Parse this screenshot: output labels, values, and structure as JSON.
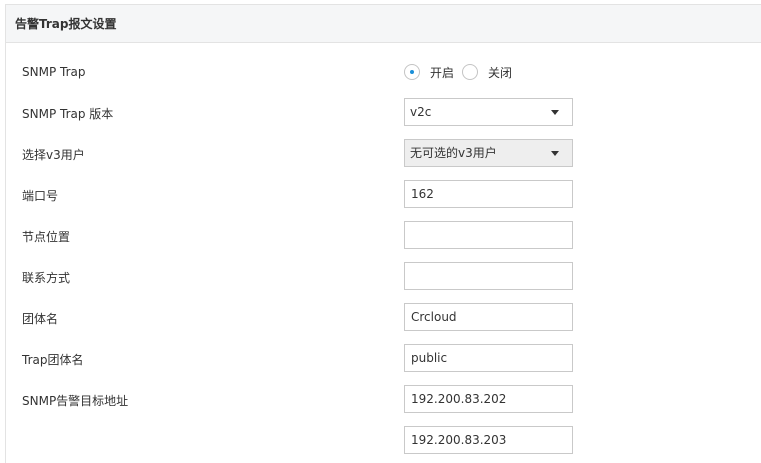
{
  "panel": {
    "title": "告警Trap报文设置"
  },
  "form": {
    "snmp_trap": {
      "label": "SNMP Trap",
      "options": [
        "开启",
        "关闭"
      ],
      "selected": "开启"
    },
    "trap_version": {
      "label": "SNMP Trap 版本",
      "value": "v2c"
    },
    "v3_user": {
      "label": "选择v3用户",
      "value": "无可选的v3用户",
      "disabled": true
    },
    "port": {
      "label": "端口号",
      "value": "162"
    },
    "node_location": {
      "label": "节点位置",
      "value": ""
    },
    "contact": {
      "label": "联系方式",
      "value": ""
    },
    "community": {
      "label": "团体名",
      "value": "Crcloud"
    },
    "trap_community": {
      "label": "Trap团体名",
      "value": "public"
    },
    "target_addresses": {
      "label": "SNMP告警目标地址",
      "values": [
        "192.200.83.202",
        "192.200.83.203"
      ]
    }
  },
  "colors": {
    "accent": "#1a8fd8",
    "header_bg": "#f5f6f7",
    "border": "#c9c9c9"
  }
}
